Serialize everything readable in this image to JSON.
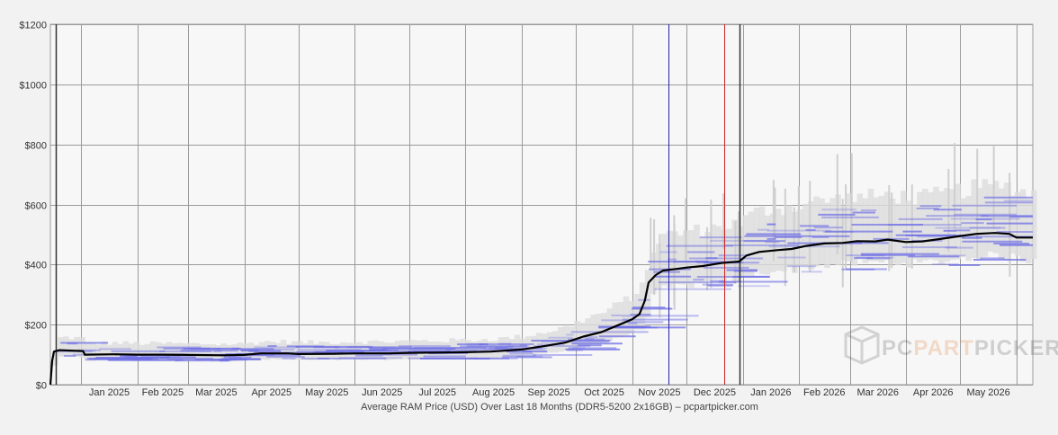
{
  "chart_data": {
    "type": "line",
    "caption": "Average RAM Price (USD) Over Last 18 Months (DDR5-5200 2x16GB) – pcpartpicker.com",
    "watermark": {
      "part1": "PC",
      "part2": "PART",
      "part3": "PICKER"
    },
    "x_tick_labels": [
      "Jan 2025",
      "Feb 2025",
      "Mar 2025",
      "Apr 2025",
      "May 2025",
      "Jun 2025",
      "Jul 2025",
      "Aug 2025",
      "Sep 2025",
      "Oct 2025",
      "Nov 2025",
      "Dec 2025",
      "Jan 2026",
      "Feb 2026",
      "Mar 2026",
      "Apr 2026",
      "May 2026"
    ],
    "y_tick_labels": [
      "$0",
      "$200",
      "$400",
      "$600",
      "$800",
      "$1000",
      "$1200"
    ],
    "y_ticks": [
      0,
      200,
      400,
      600,
      800,
      1000,
      1200
    ],
    "ylim": [
      0,
      1200
    ],
    "xlim": [
      "2024-12-15",
      "2026-06-10"
    ],
    "grid": true,
    "vertical_markers": [
      {
        "date": "2024-12-18",
        "color": "#333333"
      },
      {
        "date": "2025-11-21",
        "color": "#2222aa"
      },
      {
        "date": "2025-12-22",
        "color": "#cc2222"
      },
      {
        "date": "2025-12-30",
        "color": "#333333"
      }
    ],
    "series": [
      {
        "color": "#000000",
        "points": [
          [
            "2024-12-15",
            0
          ],
          [
            "2024-12-16",
            80
          ],
          [
            "2024-12-17",
            110
          ],
          [
            "2024-12-20",
            115
          ],
          [
            "2024-12-28",
            113
          ],
          [
            "2025-01-02",
            112
          ],
          [
            "2025-01-03",
            100
          ],
          [
            "2025-01-20",
            101
          ],
          [
            "2025-02-01",
            100
          ],
          [
            "2025-02-15",
            100
          ],
          [
            "2025-03-01",
            99
          ],
          [
            "2025-03-20",
            98
          ],
          [
            "2025-04-01",
            99
          ],
          [
            "2025-04-10",
            104
          ],
          [
            "2025-04-25",
            104
          ],
          [
            "2025-05-01",
            102
          ],
          [
            "2025-05-20",
            103
          ],
          [
            "2025-06-01",
            104
          ],
          [
            "2025-06-20",
            104
          ],
          [
            "2025-07-01",
            106
          ],
          [
            "2025-07-20",
            107
          ],
          [
            "2025-08-01",
            108
          ],
          [
            "2025-08-15",
            110
          ],
          [
            "2025-09-01",
            117
          ],
          [
            "2025-09-15",
            130
          ],
          [
            "2025-09-25",
            140
          ],
          [
            "2025-10-05",
            160
          ],
          [
            "2025-10-15",
            175
          ],
          [
            "2025-10-25",
            200
          ],
          [
            "2025-11-01",
            218
          ],
          [
            "2025-11-05",
            235
          ],
          [
            "2025-11-08",
            280
          ],
          [
            "2025-11-10",
            340
          ],
          [
            "2025-11-14",
            365
          ],
          [
            "2025-11-18",
            380
          ],
          [
            "2025-11-25",
            385
          ],
          [
            "2025-12-01",
            390
          ],
          [
            "2025-12-10",
            395
          ],
          [
            "2025-12-20",
            405
          ],
          [
            "2025-12-30",
            410
          ],
          [
            "2026-01-03",
            430
          ],
          [
            "2026-01-10",
            442
          ],
          [
            "2026-01-20",
            448
          ],
          [
            "2026-01-28",
            452
          ],
          [
            "2026-02-05",
            462
          ],
          [
            "2026-02-15",
            470
          ],
          [
            "2026-02-25",
            472
          ],
          [
            "2026-03-05",
            478
          ],
          [
            "2026-03-15",
            477
          ],
          [
            "2026-03-22",
            483
          ],
          [
            "2026-04-01",
            475
          ],
          [
            "2026-04-10",
            477
          ],
          [
            "2026-04-20",
            485
          ],
          [
            "2026-05-01",
            495
          ],
          [
            "2026-05-10",
            502
          ],
          [
            "2026-05-20",
            505
          ],
          [
            "2026-05-28",
            502
          ],
          [
            "2026-06-01",
            490
          ],
          [
            "2026-06-10",
            490
          ]
        ]
      }
    ]
  }
}
